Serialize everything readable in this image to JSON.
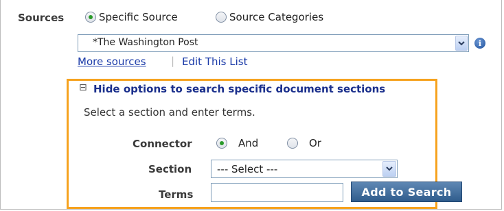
{
  "sources": {
    "label": "Sources",
    "radio_specific": "Specific Source",
    "radio_categories": "Source Categories",
    "selected_source": "*The Washington Post",
    "more_sources": "More sources",
    "separator": "|",
    "edit_list": "Edit This List"
  },
  "options": {
    "hide_toggle_glyph": "⊟",
    "hide_label": "Hide options to search specific document sections",
    "instructions": "Select a section and enter terms.",
    "connector_label": "Connector",
    "connector_and": "And",
    "connector_or": "Or",
    "section_label": "Section",
    "section_value": "--- Select ---",
    "terms_label": "Terms",
    "terms_value": "",
    "add_button": "Add to Search"
  },
  "icons": {
    "info": "i",
    "dropdown": "chevron-down"
  },
  "colors": {
    "highlight_border": "#f6a21e",
    "link": "#1a3aa8",
    "radio_selected": "#2a9a2a",
    "button_bg": "#2f5c8c"
  }
}
